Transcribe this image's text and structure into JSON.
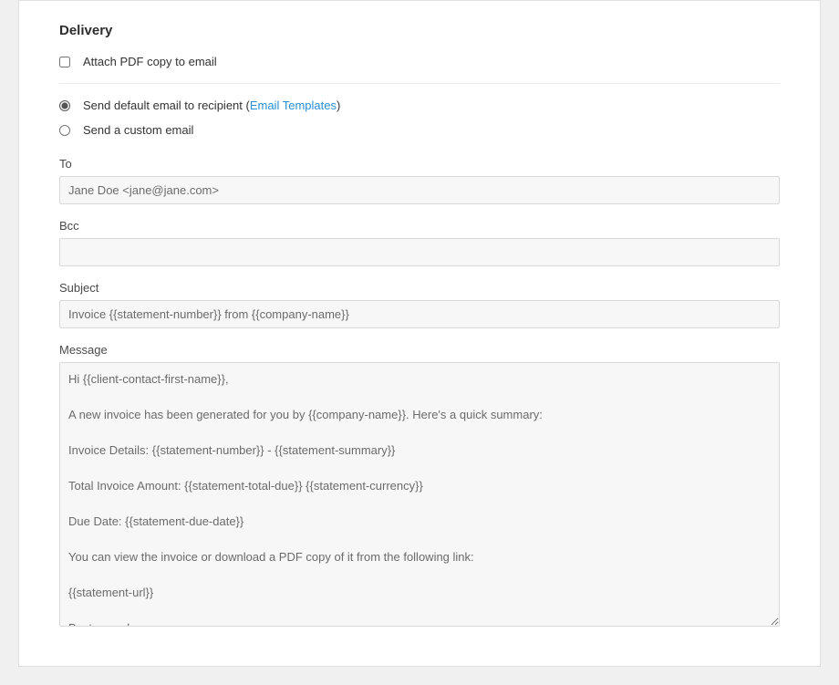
{
  "section": {
    "title": "Delivery"
  },
  "attach": {
    "label": "Attach PDF copy to email",
    "checked": false
  },
  "emailMode": {
    "default": {
      "label_pre": "Send default email to recipient (",
      "link": "Email Templates",
      "label_post": ")",
      "selected": true
    },
    "custom": {
      "label": "Send a custom email",
      "selected": false
    }
  },
  "to": {
    "label": "To",
    "value": "Jane Doe <jane@jane.com>"
  },
  "bcc": {
    "label": "Bcc",
    "value": ""
  },
  "subject": {
    "label": "Subject",
    "value": "Invoice {{statement-number}} from {{company-name}}"
  },
  "message": {
    "label": "Message",
    "value": "Hi {{client-contact-first-name}},\n\nA new invoice has been generated for you by {{company-name}}. Here's a quick summary:\n\nInvoice Details: {{statement-number}} - {{statement-summary}}\n\nTotal Invoice Amount: {{statement-total-due}} {{statement-currency}}\n\nDue Date: {{statement-due-date}}\n\nYou can view the invoice or download a PDF copy of it from the following link:\n\n{{statement-url}}\n\nBest regards,\n{{company-name}}"
  }
}
